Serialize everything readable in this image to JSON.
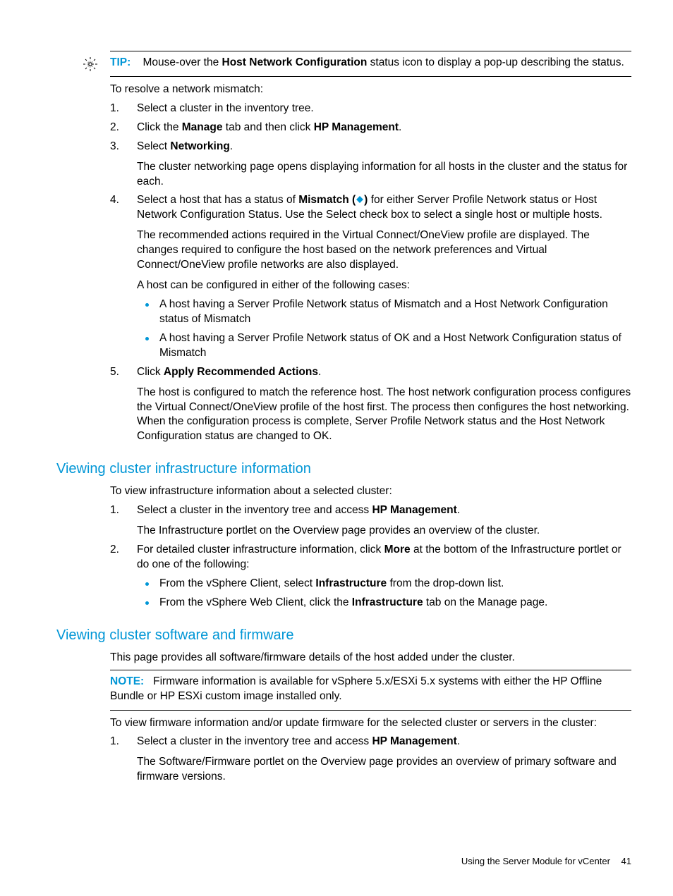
{
  "tip": {
    "label": "TIP:",
    "text_pre": "Mouse-over the ",
    "bold": "Host Network Configuration",
    "text_post": " status icon to display a pop-up describing the status."
  },
  "resolve_intro": "To resolve a network mismatch:",
  "steps": {
    "s1": {
      "n": "1.",
      "text": "Select a cluster in the inventory tree."
    },
    "s2": {
      "n": "2.",
      "pre": "Click the ",
      "b1": "Manage",
      "mid": " tab and then click ",
      "b2": "HP Management",
      "post": "."
    },
    "s3": {
      "n": "3.",
      "pre": "Select ",
      "b": "Networking",
      "post": ".",
      "p1": "The cluster networking page opens displaying information for all hosts in the cluster and the status for each."
    },
    "s4": {
      "n": "4.",
      "pre": "Select a host that has a status of ",
      "b1": "Mismatch (",
      "b2": ")",
      "post": "  for either Server Profile Network status or Host Network Configuration Status. Use the Select check box to select a single host or multiple hosts.",
      "p1": "The recommended actions required in the Virtual Connect/OneView profile are displayed. The changes required to configure the host based on the network preferences and Virtual Connect/OneView profile networks are also displayed.",
      "p2": "A host can be configured in either of the following cases:",
      "b_li1": "A host having a Server Profile Network status of Mismatch and a Host Network Configuration status of Mismatch",
      "b_li2": "A host having a Server Profile Network status of OK and a Host Network Configuration status of Mismatch"
    },
    "s5": {
      "n": "5.",
      "pre": "Click ",
      "b": "Apply Recommended Actions",
      "post": ".",
      "p1": "The host is configured to match the reference host. The host network configuration process configures the Virtual Connect/OneView profile of the host first. The process then configures the host networking. When the configuration process is complete, Server Profile Network status and the Host Network Configuration status are changed to OK."
    }
  },
  "sec1": {
    "title": "Viewing cluster infrastructure information",
    "intro": "To view infrastructure information about a selected cluster:",
    "s1": {
      "n": "1.",
      "pre": "Select a cluster in the inventory tree and access ",
      "b": "HP Management",
      "post": ".",
      "p1": "The Infrastructure portlet on the Overview page provides an overview of the cluster."
    },
    "s2": {
      "n": "2.",
      "pre": "For detailed cluster infrastructure information, click ",
      "b": "More",
      "post": " at the bottom of the Infrastructure portlet or do one of the following:",
      "li1_pre": "From the vSphere Client, select ",
      "li1_b": "Infrastructure",
      "li1_post": " from the drop-down list.",
      "li2_pre": "From the vSphere Web Client, click the ",
      "li2_b": "Infrastructure",
      "li2_post": " tab on the Manage page."
    }
  },
  "sec2": {
    "title": "Viewing cluster software and firmware",
    "intro": "This page provides all software/firmware details of the host added under the cluster.",
    "note_label": "NOTE:",
    "note_text": "Firmware information is available for vSphere 5.x/ESXi 5.x systems with either the HP Offline Bundle or HP ESXi custom image installed only.",
    "p2": "To view firmware information and/or update firmware for the selected cluster or servers in the cluster:",
    "s1": {
      "n": "1.",
      "pre": "Select a cluster in the inventory tree and access ",
      "b": "HP Management",
      "post": ".",
      "p1": "The Software/Firmware portlet on the Overview page provides an overview of primary software and firmware versions."
    }
  },
  "footer": {
    "text": "Using the Server Module for vCenter",
    "page": "41"
  }
}
